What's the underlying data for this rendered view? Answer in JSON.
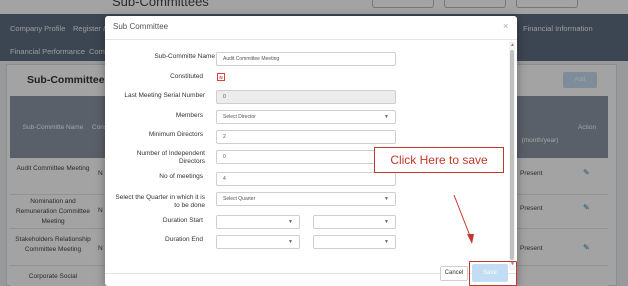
{
  "background": {
    "page_title": "Sub-Committees",
    "nav": [
      "Company Profile",
      "Register &",
      "Financial Information",
      "Financial Performance",
      "Comp"
    ],
    "card_title": "Sub-Committees",
    "add_label": "Add",
    "columns": [
      "Sub-Committe Name",
      "Consti",
      "(month/year)",
      "Action"
    ],
    "rows": [
      {
        "name": "Audit Committee Meeting",
        "constituted": "N",
        "status": "Present"
      },
      {
        "name": "Nomination and Remuneration Committee Meeting",
        "constituted": "N",
        "status": "Present"
      },
      {
        "name": "Stakeholders Relationship Committee Meeting",
        "constituted": "N",
        "status": "Present"
      },
      {
        "name": "Corporate Social",
        "constituted": "",
        "status": ""
      }
    ]
  },
  "modal": {
    "title": "Sub Committee",
    "close_icon": "close-icon",
    "fields": {
      "name": {
        "label": "Sub-Committe Name",
        "value": "Audit Committee Meeting"
      },
      "constituted": {
        "label": "Constituted",
        "value": "N"
      },
      "last_meeting": {
        "label": "Last Meeting Serial Number",
        "value": "0"
      },
      "members": {
        "label": "Members",
        "value": "Select Director"
      },
      "min_directors": {
        "label": "Minimum Directors",
        "value": "2"
      },
      "independent": {
        "label": "Number of Independent Directors",
        "value": "0"
      },
      "meetings": {
        "label": "No of meetings",
        "value": "4"
      },
      "quarter": {
        "label": "Select the Quarter in which it is to be done",
        "value": "Select Quarter"
      },
      "duration_start": {
        "label": "Duration Start"
      },
      "duration_end": {
        "label": "Duration End"
      }
    },
    "cancel_label": "Cancel",
    "save_label": "Save"
  },
  "annotation": {
    "callout": "Click Here to save",
    "color": "#c0392b"
  }
}
